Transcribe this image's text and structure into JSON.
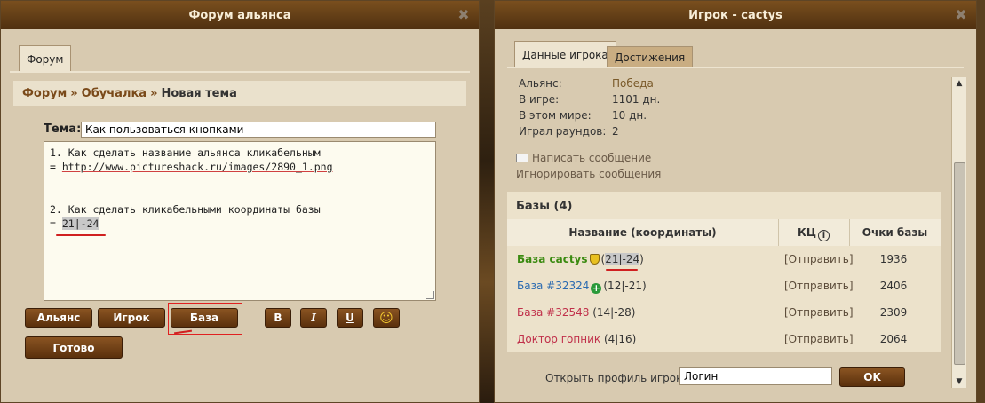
{
  "forum": {
    "title": "Форум альянса",
    "tab_forum": "Форум",
    "breadcrumb": {
      "forum": "Форум",
      "sep": "»",
      "section": "Обучалка",
      "current": "Новая тема"
    },
    "topic_label": "Тема:",
    "topic_value": "Как пользоваться кнопками",
    "editor_lines": [
      "1. Как сделать название альянса кликабельным",
      "http://www.pictureshack.ru/images/2890_1.png",
      "",
      "",
      "2. Как сделать кликабельными координаты базы",
      "21|-24"
    ],
    "eq": "=",
    "buttons": {
      "alliance": "Альянс",
      "player": "Игрок",
      "base": "База",
      "bold": "B",
      "italic": "I",
      "underline": "U",
      "smiley": "☺",
      "done": "Готово"
    }
  },
  "player": {
    "title": "Игрок - cactys",
    "tabs": {
      "data": "Данные игрока",
      "achievements": "Достижения"
    },
    "info": [
      {
        "label": "Альянс:",
        "value": "Победа"
      },
      {
        "label": "В игре:",
        "value": "1101 дн."
      },
      {
        "label": "В этом мире:",
        "value": "10 дн."
      },
      {
        "label": "Играл раундов:",
        "value": "2"
      }
    ],
    "write_message": "Написать сообщение",
    "ignore_messages": "Игнорировать сообщения",
    "bases_title": "Базы (4)",
    "cols": {
      "name": "Название (координаты)",
      "kc": "КЦ",
      "points": "Очки базы"
    },
    "bases": [
      {
        "name": "База cactys",
        "coords": "(21|-24)",
        "send": "[Отправить]",
        "points": "1936",
        "color": "#3a8a10"
      },
      {
        "name": "База #32324",
        "coords": "(12|-21)",
        "send": "[Отправить]",
        "points": "2406",
        "color": "#2a6ab0"
      },
      {
        "name": "База #32548",
        "coords": "(14|-28)",
        "send": "[Отправить]",
        "points": "2309",
        "color": "#c0304a"
      },
      {
        "name": "Доктор гопник",
        "coords": "(4|16)",
        "send": "[Отправить]",
        "points": "2064",
        "color": "#c0304a"
      }
    ],
    "profile_label": "Открыть профиль игрока:",
    "profile_placeholder": "Логин",
    "ok": "OK"
  },
  "colors": {
    "accent": "#7a4a1a",
    "button": "#6a3c14"
  }
}
